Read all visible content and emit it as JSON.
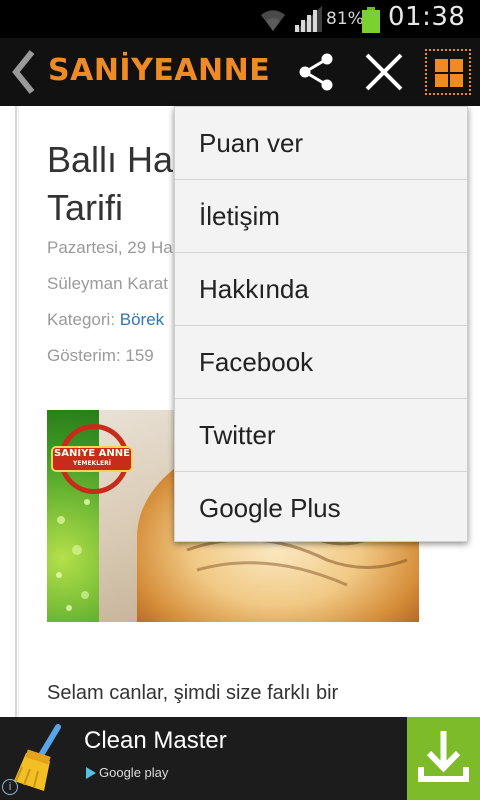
{
  "status_bar": {
    "battery_percent": "81%",
    "time": "01:38",
    "battery_color": "#7bd12f"
  },
  "action_bar": {
    "title": "SANİYEANNE",
    "accent_color": "#f08a25",
    "icons": [
      "back-chevron-icon",
      "share-icon",
      "close-icon",
      "grid-menu-icon"
    ]
  },
  "article": {
    "title_line1": "Ballı Has",
    "title_line2": "Tarifi",
    "date": "Pazartesi, 29 Ha",
    "author": "Süleyman Karat",
    "category_label": "Kategori: ",
    "category": "Börek",
    "views": "Gösterim: 159",
    "photo_logo_line1": "SANİYE ANNE",
    "photo_logo_line2": "YEMEKLERİ",
    "body_start": "Selam canlar, şimdi size farklı bir"
  },
  "menu": {
    "items": [
      "Puan ver",
      "İletişim",
      "Hakkında",
      "Facebook",
      "Twitter",
      "Google Plus"
    ]
  },
  "ad": {
    "title": "Clean Master",
    "store": "Google play",
    "download_color": "#7dbb2a"
  }
}
